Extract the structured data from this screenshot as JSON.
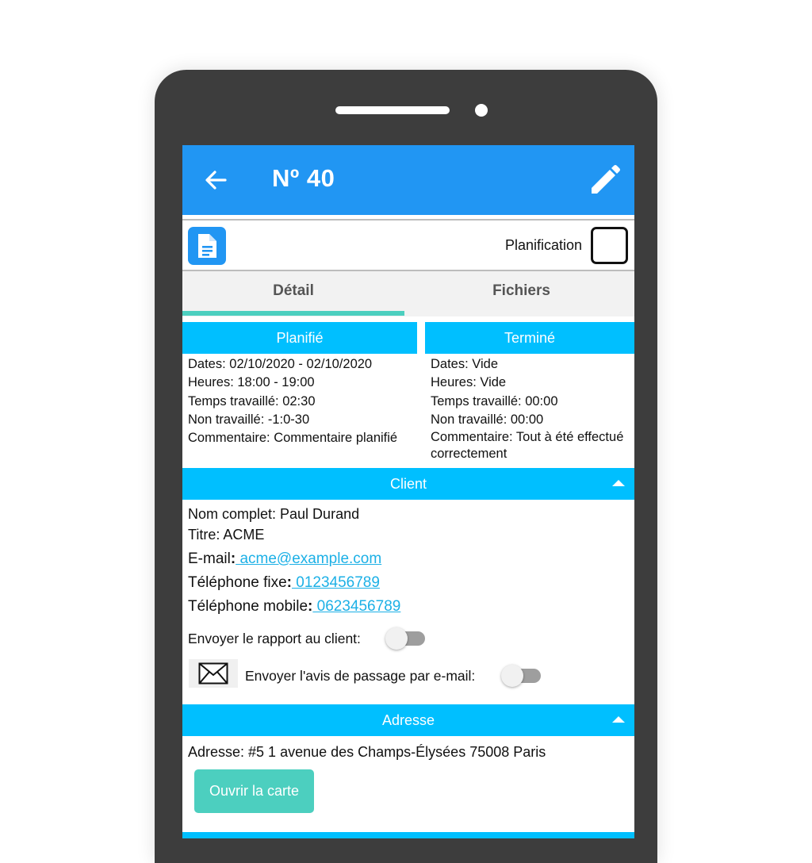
{
  "header": {
    "title": "Nº 40",
    "back_icon": "arrow-left-icon",
    "edit_icon": "pencil-icon"
  },
  "toolbar": {
    "doc_icon": "document-icon",
    "planification_label": "Planification",
    "planification_checked": false
  },
  "tabs": [
    {
      "label": "Détail",
      "active": true
    },
    {
      "label": "Fichiers",
      "active": false
    }
  ],
  "planned": {
    "title": "Planifié",
    "dates": "Dates: 02/10/2020 - 02/10/2020",
    "hours": "Heures: 18:00 - 19:00",
    "worked": "Temps travaillé: 02:30",
    "not_worked": "Non travaillé: -1:0-30",
    "comment": "Commentaire: Commentaire planifié"
  },
  "done": {
    "title": "Terminé",
    "dates": "Dates: Vide",
    "hours": "Heures: Vide",
    "worked": "Temps travaillé: 00:00",
    "not_worked": "Non travaillé: 00:00",
    "comment": "Commentaire: Tout à été effectué correctement"
  },
  "client": {
    "title": "Client",
    "full_name": "Nom complet: Paul Durand",
    "title_line": "Titre: ACME",
    "email_label": "E-mail",
    "email": " acme@example.com",
    "phone_label": "Téléphone fixe",
    "phone": " 0123456789",
    "mobile_label": "Téléphone mobile",
    "mobile": " 0623456789",
    "send_report_label": "Envoyer le rapport au client:",
    "send_report_on": false,
    "mail_icon": "envelope-icon",
    "send_notice_label": "Envoyer l'avis de passage par e-mail:",
    "send_notice_on": false
  },
  "address": {
    "title": "Adresse",
    "text": "Adresse: #5  1 avenue des Champs-Élysées 75008 Paris",
    "map_button": "Ouvrir la carte"
  },
  "colors": {
    "appbar": "#2196f3",
    "section": "#00bfff",
    "accent": "#4ccfbf",
    "link": "#1cb0e6"
  }
}
